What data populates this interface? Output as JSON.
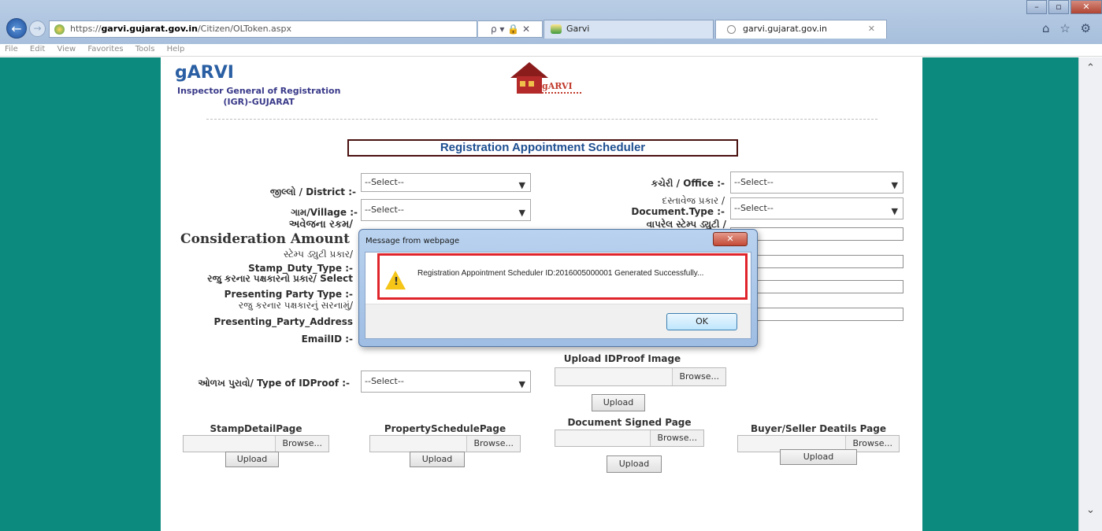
{
  "browser": {
    "url_scheme": "https://",
    "url_host": "garvi.gujarat.gov.in",
    "url_path": "/Citizen/OLToken.aspx",
    "addr_controls": "ρ ▾ 🔒 ✕",
    "tabs": [
      {
        "label": "Garvi"
      },
      {
        "label": "garvi.gujarat.gov.in"
      }
    ],
    "menu": [
      "File",
      "Edit",
      "View",
      "Favorites",
      "Tools",
      "Help"
    ],
    "toolbar_icons": "⌂ ☆ ⚙"
  },
  "header": {
    "brand": "gARVI",
    "subtitle_line1": "Inspector General of Registration",
    "subtitle_line2": "(IGR)-GUJARAT",
    "logo_text": "gARVI"
  },
  "form": {
    "title": "Registration Appointment Scheduler",
    "district_label": "જીલ્લો / District :-",
    "district_value": "--Select--",
    "office_label": "કચેરી / Office :-",
    "office_value": "--Select--",
    "village_label": "ગામ/Village :-",
    "village_value": "--Select--",
    "doctype_label_gu": "દસ્તાવેજ પ્રકાર /",
    "doctype_label": "Document.Type :-",
    "doctype_value": "--Select--",
    "consideration_gu": "અવેજના રકમ/",
    "consideration": "Consideration Amount",
    "stamp_value_gu": "વાપરેલ સ્ટેમ્પ ડ્યુટી /",
    "stamp_type_gu": "સ્ટેમ્પ ડ્યુટી પ્રકાર/",
    "stamp_type": "Stamp_Duty_Type :-",
    "party_type_gu": "રજુ કરનાર પક્ષકારનો પ્રકાર/ Select",
    "party_type": "Presenting Party Type :-",
    "party_addr_gu": "રજુ કરનાર પક્ષકારનું સરનામું/",
    "party_addr": "Presenting_Party_Address",
    "email": "EmailID :-",
    "idproof_label": "ઓળખ પુરાવો/ Type of IDProof :-",
    "idproof_value": "--Select--",
    "upload_idproof_head": "Upload IDProof Image",
    "browse": "Browse...",
    "upload": "Upload",
    "stamp_page": "StampDetailPage",
    "property_page": "PropertySchedulePage",
    "signed_page": "Document Signed Page",
    "buyer_page": "Buyer/Seller Deatils Page"
  },
  "dialog": {
    "title": "Message from webpage",
    "message": "Registration Appointment Scheduler ID:2016005000001 Generated Successfully...",
    "ok": "OK",
    "close": "✕"
  },
  "colors": {
    "side_panels": "#0b8a7d",
    "title_text": "#1d4f91",
    "highlight": "#e0242b"
  }
}
